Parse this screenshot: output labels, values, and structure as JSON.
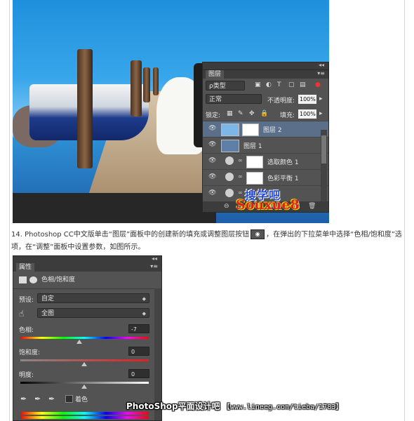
{
  "colors": {
    "panel_bg": "#535353",
    "panel_dark": "#3c3c3c",
    "active_layer": "#5b6f8a",
    "watermark_blue": "#2348d6",
    "watermark_red": "#d62323"
  },
  "layers_panel": {
    "tab_label": "图层",
    "collapse_glyph": "◂◂",
    "menu_glyph": "▾≡",
    "filter_label": "ρ类型",
    "blend_mode": "正常",
    "opacity_label": "不透明度:",
    "opacity_value": "100%",
    "lock_label": "锁定:",
    "fill_label": "填充:",
    "fill_value": "100%",
    "layers": [
      {
        "name": "图层 2",
        "active": true
      },
      {
        "name": "图层 1",
        "active": false
      },
      {
        "name": "选取颜色 1",
        "active": false
      },
      {
        "name": "色彩平衡 1",
        "active": false
      },
      {
        "name": "",
        "active": false
      },
      {
        "name": "",
        "active": false
      }
    ],
    "footer_icons": [
      "⊖",
      "fx.",
      "◘",
      "◉",
      "▭",
      "▤",
      "🗑"
    ]
  },
  "watermark": {
    "line1": "搜学吧",
    "line2": "Souxue8"
  },
  "instruction": {
    "text_before": "14. Photoshop CC中文版单击“图层”面板中的创建新的填充或调整图层按钮",
    "text_after": "，在弹出的下拉菜单中选择“色相/饱和度”选项，在“调整”面板中设置参数，如图所示。"
  },
  "properties_panel": {
    "tab_label": "属性",
    "collapse_glyph": "◂◂",
    "menu_glyph": "▾≡",
    "title": "色相/饱和度",
    "preset_label": "预设:",
    "preset_value": "自定",
    "channel_value": "全图",
    "hue_label": "色相:",
    "hue_value": "-7",
    "saturation_label": "饱和度:",
    "saturation_value": "0",
    "lightness_label": "明度:",
    "lightness_value": "0",
    "colorize_label": "着色"
  },
  "footer_watermark": {
    "brand": "PhotoShop平面设计吧",
    "url": "【www.lineeg.com/tieba/1783】"
  }
}
